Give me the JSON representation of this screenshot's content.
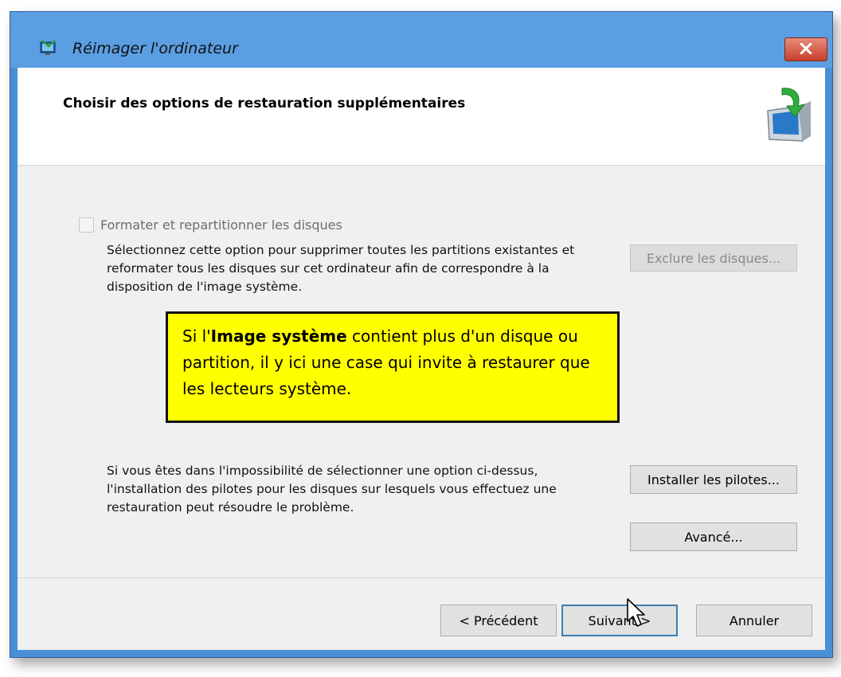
{
  "window": {
    "title": "Réimager l'ordinateur"
  },
  "header": {
    "title": "Choisir des options de restauration supplémentaires"
  },
  "format_option": {
    "label": "Formater et repartitionner les disques",
    "checked": false,
    "enabled": false,
    "description": "Sélectionnez cette option pour supprimer toutes les partitions existantes et reformater tous les disques sur cet ordinateur afin de correspondre à la disposition de l'image système."
  },
  "buttons": {
    "exclude_disks": "Exclure les disques...",
    "install_drivers": "Installer les pilotes...",
    "advanced": "Avancé...",
    "previous": "< Précédent",
    "next": "Suivant >",
    "cancel": "Annuler"
  },
  "driver_info": {
    "text": "Si vous êtes dans l'impossibilité de sélectionner une option ci-dessus, l'installation des pilotes pour les disques sur lesquels vous effectuez une restauration peut résoudre le problème."
  },
  "callout": {
    "prefix": "Si l'",
    "bold": "Image système",
    "suffix": " contient plus d'un disque ou partition, il y ici une case qui invite à restaurer que les lecteurs système."
  },
  "colors": {
    "title_bar": "#5b9ee2",
    "close_button": "#c7402d",
    "callout_background": "#ffff00",
    "default_button_border": "#3c7fb1"
  },
  "icons": [
    "restore-window-icon",
    "close-icon",
    "monitor-restore-icon",
    "mouse-pointer-icon"
  ]
}
